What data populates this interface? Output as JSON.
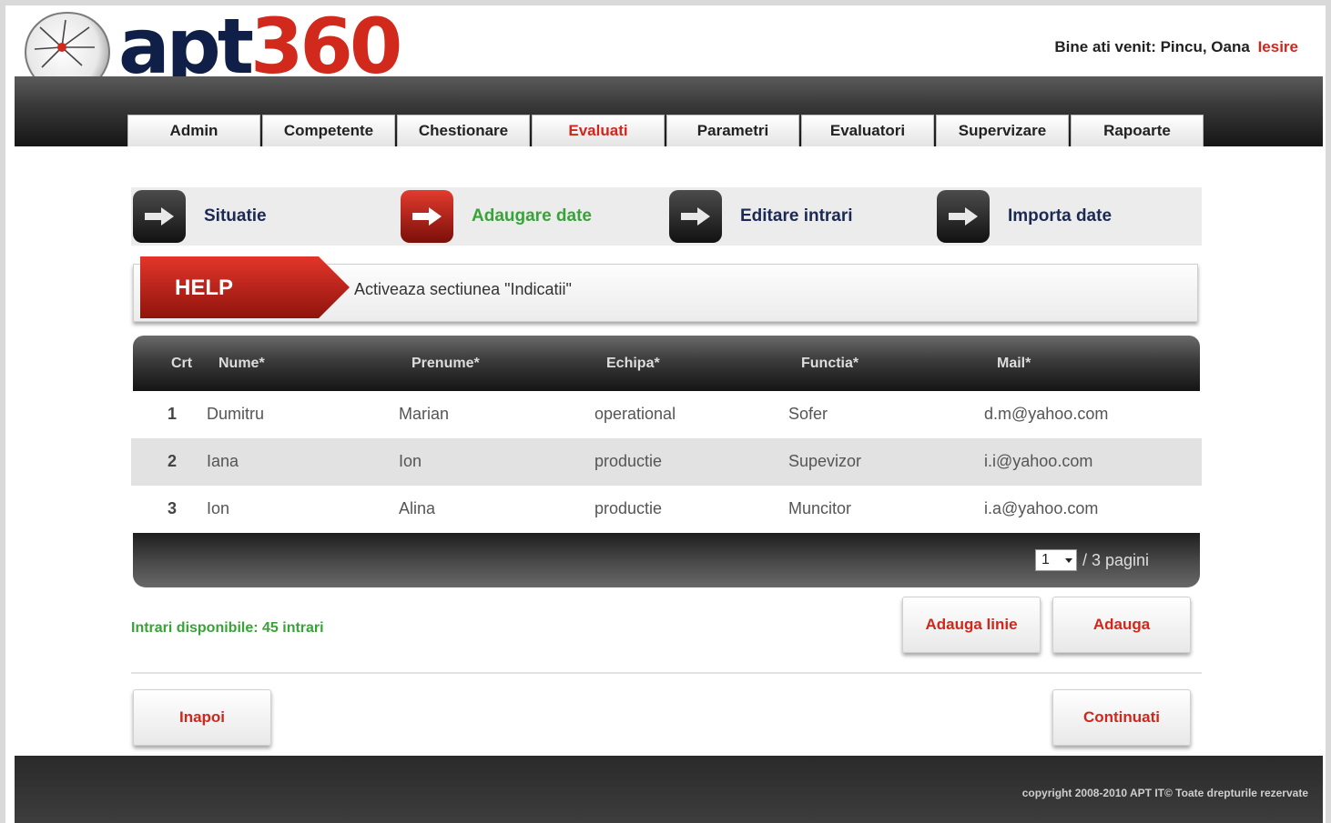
{
  "header": {
    "logo": {
      "part1": "apt",
      "part2": "360"
    },
    "welcome_text": "Bine ati venit: Pincu, Oana",
    "logout_label": "Iesire"
  },
  "nav": {
    "tabs": [
      "Admin",
      "Competente",
      "Chestionare",
      "Evaluati",
      "Parametri",
      "Evaluatori",
      "Supervizare",
      "Rapoarte"
    ],
    "active": "Evaluati"
  },
  "steps": [
    {
      "label": "Situatie",
      "active": false
    },
    {
      "label": "Adaugare date",
      "active": true
    },
    {
      "label": "Editare intrari",
      "active": false
    },
    {
      "label": "Importa date",
      "active": false
    }
  ],
  "help": {
    "tag": "HELP",
    "text": "Activeaza sectiunea \"Indicatii\""
  },
  "table": {
    "columns": [
      "Crt",
      "Nume*",
      "Prenume*",
      "Echipa*",
      "Functia*",
      "Mail*"
    ],
    "rows": [
      {
        "crt": "1",
        "nume": "Dumitru",
        "prenume": "Marian",
        "echipa": "operational",
        "functia": "Sofer",
        "mail": "d.m@yahoo.com"
      },
      {
        "crt": "2",
        "nume": "Iana",
        "prenume": "Ion",
        "echipa": "productie",
        "functia": "Supevizor",
        "mail": "i.i@yahoo.com"
      },
      {
        "crt": "3",
        "nume": "Ion",
        "prenume": "Alina",
        "echipa": "productie",
        "functia": "Muncitor",
        "mail": "i.a@yahoo.com"
      }
    ]
  },
  "pagination": {
    "current_page": "1",
    "total_text": "/ 3 pagini"
  },
  "available_entries": "Intrari disponibile: 45 intrari",
  "buttons": {
    "add_line": "Adauga linie",
    "add": "Adauga",
    "back": "Inapoi",
    "continue": "Continuati"
  },
  "footer": {
    "copyright": "copyright 2008-2010 APT IT© Toate drepturile rezervate"
  },
  "colors": {
    "accent_red": "#d0271d",
    "green": "#37a437",
    "navy": "#1b2a55"
  }
}
